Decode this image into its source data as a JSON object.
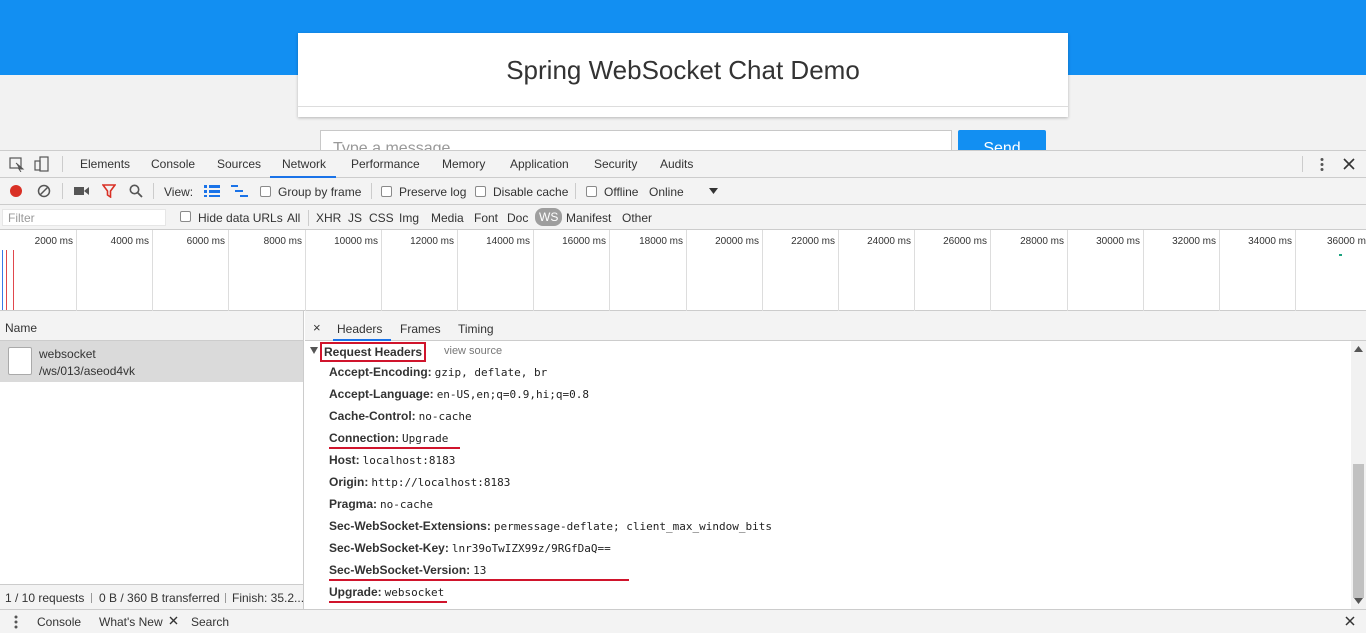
{
  "page": {
    "title": "Spring WebSocket Chat Demo",
    "message_placeholder": "Type a message...",
    "send_label": "Send"
  },
  "devtools": {
    "tabs": [
      "Elements",
      "Console",
      "Sources",
      "Network",
      "Performance",
      "Memory",
      "Application",
      "Security",
      "Audits"
    ],
    "active_tab": "Network",
    "toolbar": {
      "view_label": "View:",
      "group_by_frame": "Group by frame",
      "preserve_log": "Preserve log",
      "disable_cache": "Disable cache",
      "offline": "Offline",
      "throttle": "Online"
    },
    "filter": {
      "placeholder": "Filter",
      "hide_data_urls": "Hide data URLs",
      "types": [
        "All",
        "XHR",
        "JS",
        "CSS",
        "Img",
        "Media",
        "Font",
        "Doc",
        "WS",
        "Manifest",
        "Other"
      ],
      "active_type": "WS"
    },
    "timeline_ticks": [
      "2000 ms",
      "4000 ms",
      "6000 ms",
      "8000 ms",
      "10000 ms",
      "12000 ms",
      "14000 ms",
      "16000 ms",
      "18000 ms",
      "20000 ms",
      "22000 ms",
      "24000 ms",
      "26000 ms",
      "28000 ms",
      "30000 ms",
      "32000 ms",
      "34000 ms",
      "36000 m"
    ],
    "requests": {
      "column": "Name",
      "items": [
        {
          "name": "websocket",
          "path": "/ws/013/aseod4vk"
        }
      ],
      "status": {
        "count": "1 / 10 requests",
        "transferred": "0 B / 360 B transferred",
        "finish": "Finish: 35.2..."
      }
    },
    "details": {
      "close": "×",
      "tabs": [
        "Headers",
        "Frames",
        "Timing"
      ],
      "active_tab": "Headers",
      "section_title": "Request Headers",
      "view_source": "view source",
      "headers": [
        {
          "key": "Accept-Encoding:",
          "value": "gzip, deflate, br"
        },
        {
          "key": "Accept-Language:",
          "value": "en-US,en;q=0.9,hi;q=0.8"
        },
        {
          "key": "Cache-Control:",
          "value": "no-cache"
        },
        {
          "key": "Connection:",
          "value": "Upgrade"
        },
        {
          "key": "Host:",
          "value": "localhost:8183"
        },
        {
          "key": "Origin:",
          "value": "http://localhost:8183"
        },
        {
          "key": "Pragma:",
          "value": "no-cache"
        },
        {
          "key": "Sec-WebSocket-Extensions:",
          "value": "permessage-deflate; client_max_window_bits"
        },
        {
          "key": "Sec-WebSocket-Key:",
          "value": "lnr39oTwIZX99z/9RGfDaQ=="
        },
        {
          "key": "Sec-WebSocket-Version:",
          "value": "13"
        },
        {
          "key": "Upgrade:",
          "value": "websocket"
        }
      ]
    },
    "drawer": {
      "tabs": [
        "Console",
        "What's New",
        "Search"
      ]
    },
    "accent_color": "#1a73e8",
    "highlight_color": "#d0142c"
  }
}
